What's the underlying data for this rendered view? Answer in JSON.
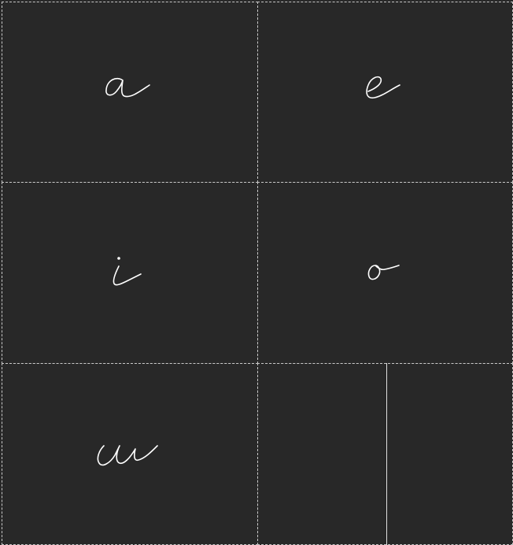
{
  "cards": [
    {
      "letter": "a"
    },
    {
      "letter": "e"
    },
    {
      "letter": "i"
    },
    {
      "letter": "o"
    },
    {
      "letter": "u"
    }
  ],
  "colors": {
    "background": "#282828",
    "glyph": "#ffffff",
    "cell_border": "#c8c8c8"
  }
}
